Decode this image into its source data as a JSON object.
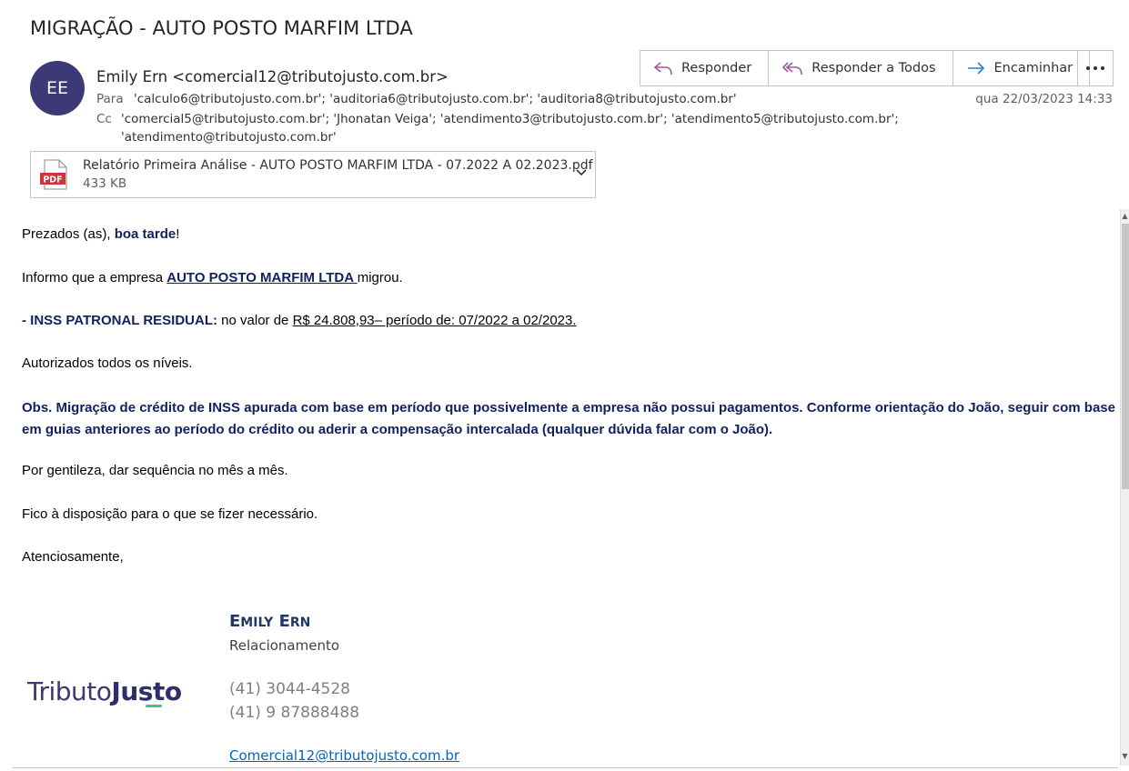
{
  "email": {
    "subject": "MIGRAÇÃO - AUTO POSTO MARFIM LTDA",
    "avatar_initials": "EE",
    "avatar_color": "#3b3a76",
    "sender": "Emily Ern <comercial12@tributojusto.com.br>",
    "to_label": "Para",
    "to": "'calculo6@tributojusto.com.br'; 'auditoria6@tributojusto.com.br'; 'auditoria8@tributojusto.com.br'",
    "cc_label": "Cc",
    "cc_line1": "'comercial5@tributojusto.com.br'; 'Jhonatan Veiga'; 'atendimento3@tributojusto.com.br'; 'atendimento5@tributojusto.com.br';",
    "cc_line2": "'atendimento@tributojusto.com.br'",
    "date": "qua 22/03/2023 14:33"
  },
  "actions": {
    "reply": "Responder",
    "reply_all": "Responder a Todos",
    "forward": "Encaminhar",
    "more_icon": "ellipsis-icon"
  },
  "attachment": {
    "icon": "pdf-file-icon",
    "icon_label": "PDF",
    "name": "Relatório Primeira Análise - AUTO POSTO MARFIM LTDA - 07.2022 A 02.2023.pdf",
    "size": "433 KB"
  },
  "body": {
    "greeting_pre": "Prezados (as), ",
    "greeting_bold": "boa tarde",
    "greeting_post": "!",
    "inform_pre": "Informo que a empresa ",
    "inform_company": "AUTO POSTO MARFIM LTDA ",
    "inform_post": "migrou.",
    "inss_label": "- INSS PATRONAL RESIDUAL:",
    "inss_mid": " no valor de ",
    "inss_value": "R$ 24.808,93– período de: 07/2022 a 02/2023.",
    "authorized": "Autorizados todos os níveis.",
    "obs": "Obs. Migração de crédito de INSS apurada com base em período que possivelmente a empresa não possui pagamentos. Conforme orientação do João, seguir com base em guias anteriores ao período do crédito ou aderir a compensação intercalada (qualquer dúvida falar com o João).",
    "please": "Por gentileza, dar sequência no mês a mês.",
    "available": "Fico à disposição para o que se fizer necessário.",
    "regards": "Atenciosamente,"
  },
  "signature": {
    "name_first_initial": "E",
    "name_first_rest": "MILY",
    "name_last_initial": "E",
    "name_last_rest": "RN",
    "role": "Relacionamento",
    "phone1": "(41) 3044-4528",
    "phone2": "(41) 9 87888488",
    "email": "Comercial12@tributojusto.com.br",
    "logo_part1": "Tributo",
    "logo_part2": "Justo"
  }
}
